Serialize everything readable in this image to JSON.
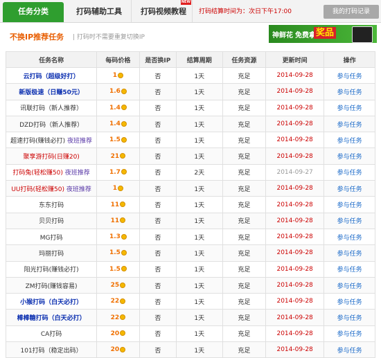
{
  "tabs": [
    {
      "label": "任务分类"
    },
    {
      "label": "打码辅助工具"
    },
    {
      "label": "打码视频教程",
      "badge": "NEW"
    }
  ],
  "notice": {
    "label": "打码结算时间为：",
    "time": "次日下午17:00"
  },
  "record_button": "我的打码记录",
  "section": {
    "title": "不换IP推荐任务",
    "subtitle": "| 打码时不需要重复切换IP"
  },
  "banner": {
    "text1": "神鲜花",
    "text2": "免费拿",
    "text3": "奖品"
  },
  "table": {
    "headers": [
      "任务名称",
      "每码价格",
      "是否换IP",
      "结算周期",
      "任务资源",
      "更新时间",
      "操作"
    ],
    "rows": [
      {
        "name": "云打码（超级好打）",
        "style": "blue",
        "extra": "",
        "price": "1",
        "ip": "否",
        "cycle": "1天",
        "res": "充足",
        "date": "2014-09-28",
        "gray": false,
        "op": "参与任务"
      },
      {
        "name": "新版极速（日赚50元）",
        "style": "blue",
        "extra": "",
        "price": "1.6",
        "ip": "否",
        "cycle": "1天",
        "res": "充足",
        "date": "2014-09-28",
        "gray": false,
        "op": "参与任务"
      },
      {
        "name": "讯联打码（新人推荐）",
        "style": "plain",
        "extra": "",
        "price": "1.4",
        "ip": "否",
        "cycle": "1天",
        "res": "充足",
        "date": "2014-09-28",
        "gray": false,
        "op": "参与任务"
      },
      {
        "name": "DZD打码（新人推荐）",
        "style": "plain",
        "extra": "",
        "price": "1.4",
        "ip": "否",
        "cycle": "1天",
        "res": "充足",
        "date": "2014-09-28",
        "gray": false,
        "op": "参与任务"
      },
      {
        "name": "超速打码(赚钱必打)",
        "style": "plain",
        "extra": "夜班推荐",
        "price": "1.5",
        "ip": "否",
        "cycle": "1天",
        "res": "充足",
        "date": "2014-09-28",
        "gray": false,
        "op": "参与任务"
      },
      {
        "name": "聚享游打码(日赚20)",
        "style": "red",
        "extra": "",
        "price": "21",
        "ip": "否",
        "cycle": "1天",
        "res": "充足",
        "date": "2014-09-28",
        "gray": false,
        "op": "参与任务"
      },
      {
        "name": "打码兔(轻松赚50)",
        "style": "red",
        "extra": "夜班推荐",
        "price": "1.7",
        "ip": "否",
        "cycle": "2天",
        "res": "充足",
        "date": "2014-09-27",
        "gray": true,
        "op": "参与任务"
      },
      {
        "name": "UU打码(轻松赚50)",
        "style": "red",
        "extra": "夜班推荐",
        "price": "1",
        "ip": "否",
        "cycle": "1天",
        "res": "充足",
        "date": "2014-09-28",
        "gray": false,
        "op": "参与任务"
      },
      {
        "name": "东东打码",
        "style": "plain",
        "extra": "",
        "price": "11",
        "ip": "否",
        "cycle": "1天",
        "res": "充足",
        "date": "2014-09-28",
        "gray": false,
        "op": "参与任务"
      },
      {
        "name": "贝贝打码",
        "style": "plain",
        "extra": "",
        "price": "11",
        "ip": "否",
        "cycle": "1天",
        "res": "充足",
        "date": "2014-09-28",
        "gray": false,
        "op": "参与任务"
      },
      {
        "name": "MG打码",
        "style": "plain",
        "extra": "",
        "price": "1.3",
        "ip": "否",
        "cycle": "1天",
        "res": "充足",
        "date": "2014-09-28",
        "gray": false,
        "op": "参与任务"
      },
      {
        "name": "玛丽打码",
        "style": "plain",
        "extra": "",
        "price": "1.5",
        "ip": "否",
        "cycle": "1天",
        "res": "充足",
        "date": "2014-09-28",
        "gray": false,
        "op": "参与任务"
      },
      {
        "name": "阳光打码(赚钱必打)",
        "style": "plain",
        "extra": "",
        "price": "1.5",
        "ip": "否",
        "cycle": "1天",
        "res": "充足",
        "date": "2014-09-28",
        "gray": false,
        "op": "参与任务"
      },
      {
        "name": "ZM打码(赚钱容易)",
        "style": "plain",
        "extra": "",
        "price": "25",
        "ip": "否",
        "cycle": "1天",
        "res": "充足",
        "date": "2014-09-28",
        "gray": false,
        "op": "参与任务"
      },
      {
        "name": "小猴打码（白天必打）",
        "style": "blue",
        "extra": "",
        "price": "22",
        "ip": "否",
        "cycle": "1天",
        "res": "充足",
        "date": "2014-09-28",
        "gray": false,
        "op": "参与任务"
      },
      {
        "name": "棒棒糖打码（白天必打）",
        "style": "blue",
        "extra": "",
        "price": "22",
        "ip": "否",
        "cycle": "1天",
        "res": "充足",
        "date": "2014-09-28",
        "gray": false,
        "op": "参与任务"
      },
      {
        "name": "CA打码",
        "style": "plain",
        "extra": "",
        "price": "20",
        "ip": "否",
        "cycle": "1天",
        "res": "充足",
        "date": "2014-09-28",
        "gray": false,
        "op": "参与任务"
      },
      {
        "name": "101打码（稳定出码）",
        "style": "plain",
        "extra": "",
        "price": "20",
        "ip": "否",
        "cycle": "1天",
        "res": "充足",
        "date": "2014-09-28",
        "gray": false,
        "op": "参与任务"
      }
    ]
  }
}
